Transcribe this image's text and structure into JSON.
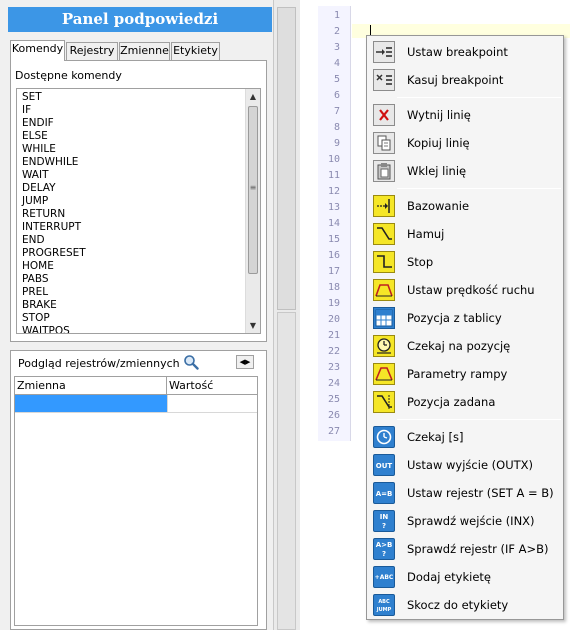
{
  "panel": {
    "title": "Panel podpowiedzi",
    "tabs": [
      "Komendy",
      "Rejestry",
      "Zmienne",
      "Etykiety"
    ],
    "commands_label": "Dostępne komendy",
    "commands": [
      "SET",
      "IF",
      "ENDIF",
      "ELSE",
      "WHILE",
      "ENDWHILE",
      "WAIT",
      "DELAY",
      "JUMP",
      "RETURN",
      "INTERRUPT",
      "END",
      "PROGRESET",
      "HOME",
      "PABS",
      "PREL",
      "BRAKE",
      "STOP",
      "WAITPOS"
    ],
    "registers_label": "Podgląd rejestrów/zmiennych",
    "registers_columns": [
      "Zmienna",
      "Wartość"
    ]
  },
  "editor": {
    "line_numbers": [
      "1",
      "2",
      "3",
      "4",
      "5",
      "6",
      "7",
      "8",
      "9",
      "10",
      "11",
      "12",
      "13",
      "14",
      "15",
      "16",
      "17",
      "18",
      "19",
      "20",
      "21",
      "22",
      "23",
      "24",
      "25",
      "26",
      "27"
    ]
  },
  "context_menu": {
    "items": [
      {
        "label": "Ustaw breakpoint",
        "icon": "set-breakpoint-icon"
      },
      {
        "label": "Kasuj breakpoint",
        "icon": "clear-breakpoint-icon"
      },
      {
        "label": "Wytnij linię",
        "icon": "cut-line-icon"
      },
      {
        "label": "Kopiuj linię",
        "icon": "copy-line-icon"
      },
      {
        "label": "Wklej linię",
        "icon": "paste-line-icon"
      },
      {
        "label": "Bazowanie",
        "icon": "homing-icon"
      },
      {
        "label": "Hamuj",
        "icon": "brake-icon"
      },
      {
        "label": "Stop",
        "icon": "stop-icon"
      },
      {
        "label": "Ustaw prędkość ruchu",
        "icon": "set-speed-icon"
      },
      {
        "label": "Pozycja z tablicy",
        "icon": "position-table-icon"
      },
      {
        "label": "Czekaj na pozycję",
        "icon": "wait-position-icon"
      },
      {
        "label": "Parametry rampy",
        "icon": "ramp-params-icon"
      },
      {
        "label": "Pozycja zadana",
        "icon": "target-position-icon"
      },
      {
        "label": "Czekaj [s]",
        "icon": "wait-seconds-icon"
      },
      {
        "label": "Ustaw wyjście (OUTX)",
        "icon": "set-output-icon"
      },
      {
        "label": "Ustaw rejestr (SET A = B)",
        "icon": "set-register-icon"
      },
      {
        "label": "Sprawdź wejście (INX)",
        "icon": "check-input-icon"
      },
      {
        "label": "Sprawdź rejestr (IF A>B)",
        "icon": "check-register-icon"
      },
      {
        "label": "Dodaj etykietę",
        "icon": "add-label-icon"
      },
      {
        "label": "Skocz do etykiety",
        "icon": "jump-label-icon"
      }
    ],
    "icon_text": {
      "out": "OUT",
      "ab_top": "A=B",
      "in_top": "IN",
      "in_bot": "?",
      "agtb_top": "A>B",
      "agtb_bot": "?",
      "abc": "+ABC",
      "jump_top": "ABC",
      "jump_bot": "JUMP"
    }
  },
  "colors": {
    "title_bg": "#3c96e6",
    "selection": "#3399ff",
    "current_line": "#ffffdf",
    "icon_yellow": "#f5e627",
    "icon_blue": "#2f80cf"
  }
}
